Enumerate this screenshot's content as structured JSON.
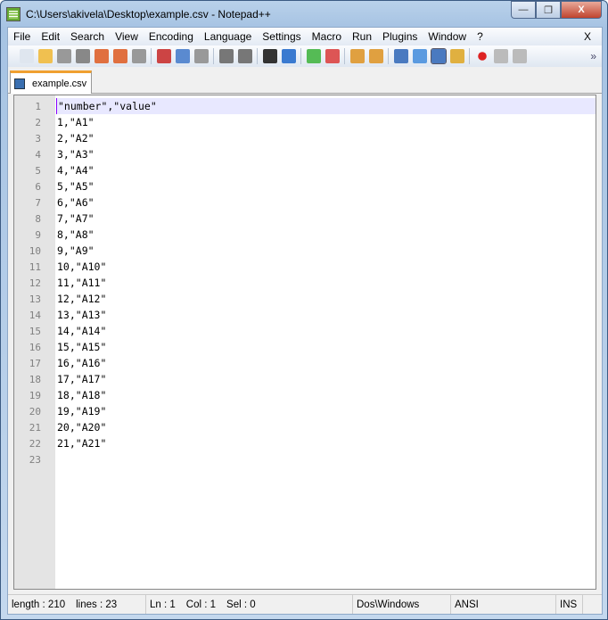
{
  "window": {
    "title": "C:\\Users\\akivela\\Desktop\\example.csv - Notepad++",
    "min": "—",
    "max": "❐",
    "close": "X"
  },
  "menu": [
    "File",
    "Edit",
    "Search",
    "View",
    "Encoding",
    "Language",
    "Settings",
    "Macro",
    "Run",
    "Plugins",
    "Window",
    "?"
  ],
  "menu_close": "X",
  "toolbar_overflow": "»",
  "tab": {
    "label": "example.csv"
  },
  "lines": [
    "\"number\",\"value\"",
    "1,\"A1\"",
    "2,\"A2\"",
    "3,\"A3\"",
    "4,\"A4\"",
    "5,\"A5\"",
    "6,\"A6\"",
    "7,\"A7\"",
    "8,\"A8\"",
    "9,\"A9\"",
    "10,\"A10\"",
    "11,\"A11\"",
    "12,\"A12\"",
    "13,\"A13\"",
    "14,\"A14\"",
    "15,\"A15\"",
    "16,\"A16\"",
    "17,\"A17\"",
    "18,\"A18\"",
    "19,\"A19\"",
    "20,\"A20\"",
    "21,\"A21\"",
    ""
  ],
  "status": {
    "length": "length : 210",
    "lines": "lines : 23",
    "ln": "Ln : 1",
    "col": "Col : 1",
    "sel": "Sel : 0",
    "eol": "Dos\\Windows",
    "encoding": "ANSI",
    "mode": "INS"
  }
}
